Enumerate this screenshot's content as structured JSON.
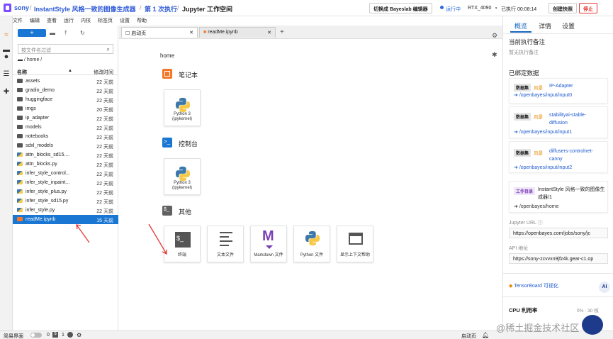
{
  "header": {
    "user": "sony",
    "project": "InstantStyle 风格一致的图像生成器",
    "run": "第 1 次执行",
    "workspace": "Jupyter 工作空间",
    "switch_button": "切换成 Bayeslab 编辑器",
    "status": "运行中",
    "gpu": "RTX_4090",
    "elapsed": "已执行 00:08:14",
    "snapshot_button": "创建快照",
    "stop_button": "停止"
  },
  "menu": [
    "文件",
    "编辑",
    "查看",
    "运行",
    "内核",
    "标签页",
    "设置",
    "帮助"
  ],
  "filebrowser": {
    "new_label": "+",
    "filter_placeholder": "按文件名过滤",
    "path": "/ home /",
    "col_name": "名称",
    "col_modified": "修改时间",
    "files": [
      {
        "name": "assets",
        "date": "22 天前",
        "type": "folder"
      },
      {
        "name": "gradio_demo",
        "date": "22 天前",
        "type": "folder"
      },
      {
        "name": "huggingface",
        "date": "22 天前",
        "type": "folder"
      },
      {
        "name": "imgs",
        "date": "20 天前",
        "type": "folder"
      },
      {
        "name": "ip_adapter",
        "date": "22 天前",
        "type": "folder"
      },
      {
        "name": "models",
        "date": "22 天前",
        "type": "folder"
      },
      {
        "name": "notebooks",
        "date": "22 天前",
        "type": "folder"
      },
      {
        "name": "sdxl_models",
        "date": "22 天前",
        "type": "folder"
      },
      {
        "name": "attn_blocks_sd15....",
        "date": "22 天前",
        "type": "py"
      },
      {
        "name": "attn_blocks.py",
        "date": "22 天前",
        "type": "py"
      },
      {
        "name": "infer_style_control...",
        "date": "22 天前",
        "type": "py"
      },
      {
        "name": "infer_style_inpaint...",
        "date": "22 天前",
        "type": "py"
      },
      {
        "name": "infer_style_plus.py",
        "date": "22 天前",
        "type": "py"
      },
      {
        "name": "infer_style_sd15.py",
        "date": "22 天前",
        "type": "py"
      },
      {
        "name": "infer_style.py",
        "date": "22 天前",
        "type": "py"
      },
      {
        "name": "readMe.ipynb",
        "date": "15 天前",
        "type": "nb"
      }
    ]
  },
  "tabs": [
    {
      "label": "启动页"
    },
    {
      "label": "readMe.ipynb"
    }
  ],
  "launcher": {
    "path": "home",
    "notebook_title": "笔记本",
    "console_title": "控制台",
    "other_title": "其他",
    "kernel_caption_1": "Python 3",
    "kernel_caption_2": "(ipykernel)",
    "other_items": [
      "终端",
      "文本文件",
      "Markdown 文件",
      "Python 文件",
      "显示上下文帮助"
    ]
  },
  "right_panel": {
    "tabs": [
      "概览",
      "详情",
      "设置"
    ],
    "notes_title": "当前执行备注",
    "notes_empty": "暂无执行备注",
    "bound_title": "已绑定数据",
    "datasets": [
      {
        "badge": "数据集",
        "kind": "风景",
        "name": "IP-Adapter",
        "path": "/openbayes/input/input0"
      },
      {
        "badge": "数据集",
        "kind": "风景",
        "name": "stabilityai-stable-diffusion",
        "path": "/openbayes/input/input1"
      },
      {
        "badge": "数据集",
        "kind": "风景",
        "name": "diffusers-controlnet-canny",
        "path": "/openbayes/input/input2"
      }
    ],
    "workdir_badge": "工作目录",
    "workdir_name": "InstantStyle 风格一致的图像生成器/1",
    "workdir_path": "/openbayes/home",
    "jupyter_url_label": "Jupyter URL",
    "jupyter_url": "https://openbayes.com/jobs/sony/jc",
    "api_label": "API 地址",
    "api_url": "https://sony-zcvvxn9jfz4k.gear-c1.op",
    "tensorboard": "TensorBoard 可视化",
    "cpu_label": "CPU 利用率",
    "cpu_value": "0% · 30 核"
  },
  "statusbar": {
    "simple_mode": "简易界面",
    "zero": "0",
    "one": "1",
    "launcher": "启动页",
    "ai_badge": "AI"
  },
  "watermark": "@稀土掘金技术社区"
}
